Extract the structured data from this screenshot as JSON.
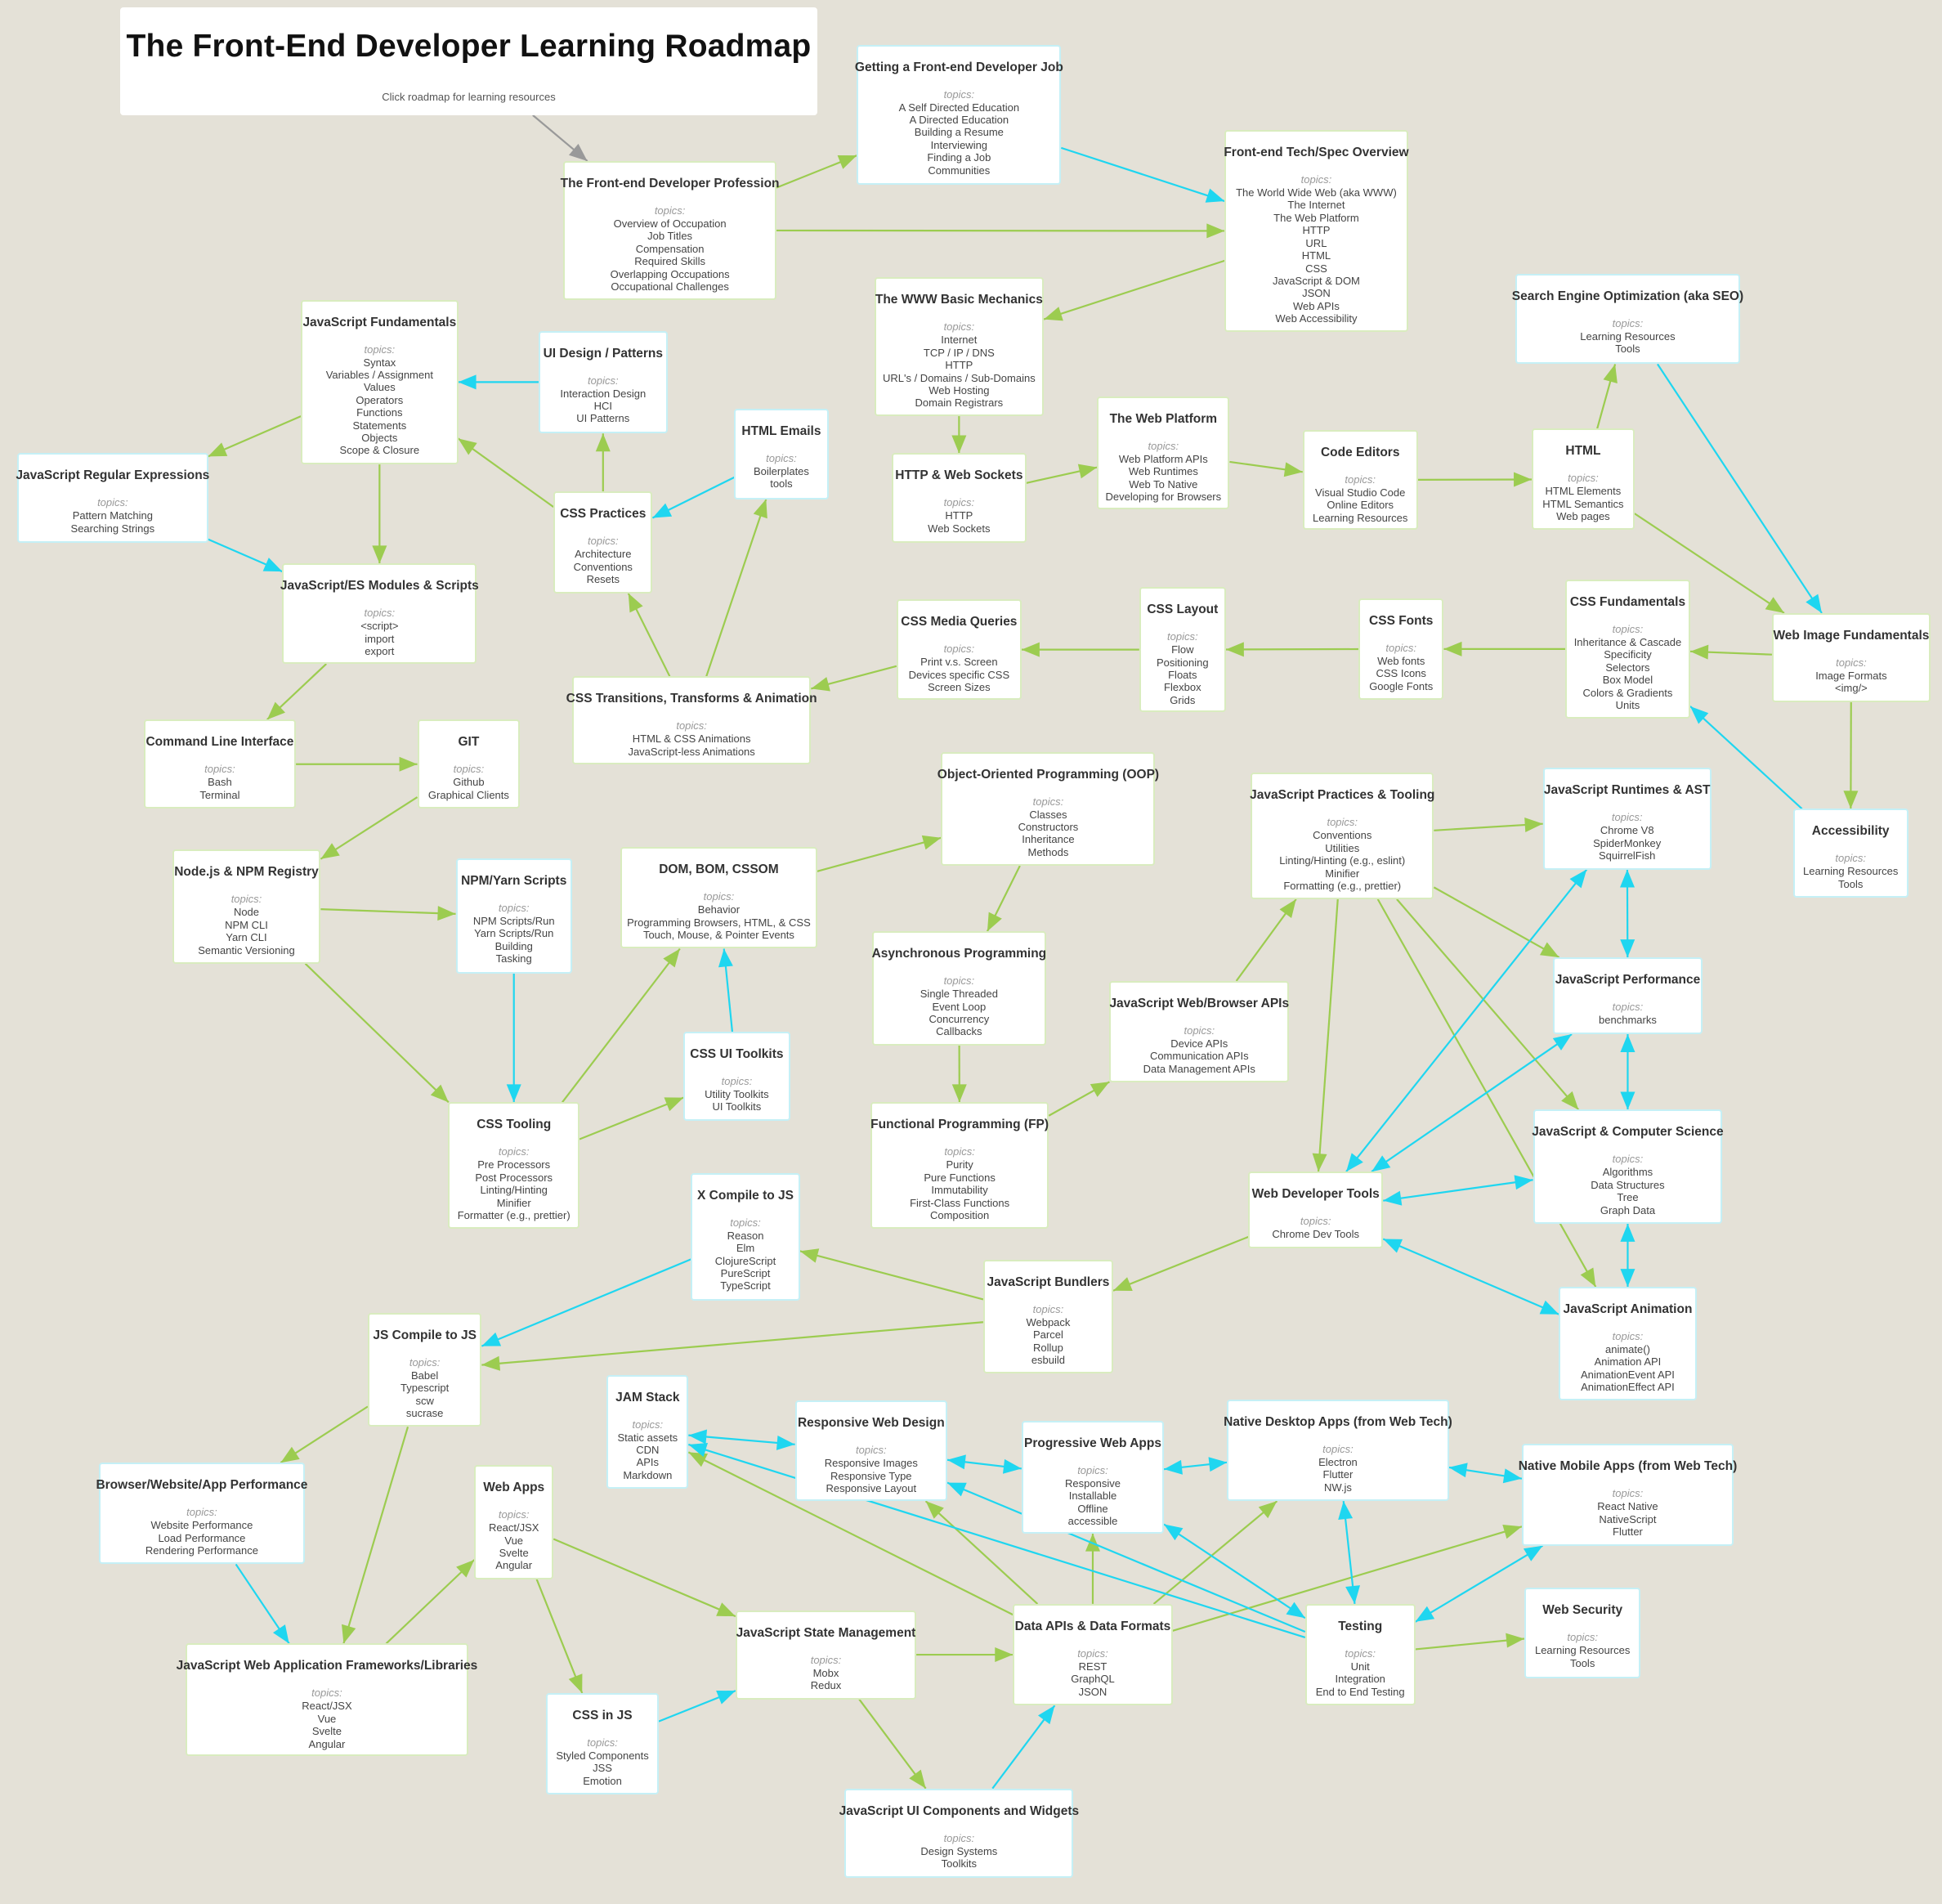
{
  "title": "The Front-End Developer Learning Roadmap",
  "subtitle": "Click roadmap for learning resources",
  "topics_label": "topics:",
  "colors": {
    "background": "#e4e1d7",
    "green_edge": "#9ccc50",
    "cyan_edge": "#1fd6f0",
    "gray_edge": "#999999",
    "box": "#ffffff"
  },
  "nodes": [
    {
      "id": "profession",
      "title": "The Front-end Developer Profession",
      "topics": [
        "Overview of Occupation",
        "Job Titles",
        "Compensation",
        "Required Skills",
        "Overlapping Occupations",
        "Occupational Challenges"
      ],
      "border": "green"
    },
    {
      "id": "job",
      "title": "Getting a Front-end Developer Job",
      "topics": [
        "A Self Directed Education",
        "A Directed Education",
        "Building a Resume",
        "Interviewing",
        "Finding a Job",
        "Communities"
      ],
      "border": "cyan"
    },
    {
      "id": "techspec",
      "title": "Front-end Tech/Spec Overview",
      "topics": [
        "The World Wide Web (aka WWW)",
        "The Internet",
        "The Web Platform",
        "HTTP",
        "URL",
        "HTML",
        "CSS",
        "JavaScript & DOM",
        "JSON",
        "Web APIs",
        "Web Accessibility"
      ],
      "border": "green"
    },
    {
      "id": "www",
      "title": "The WWW Basic Mechanics",
      "topics": [
        "Internet",
        "TCP / IP / DNS",
        "HTTP",
        "URL's / Domains / Sub-Domains",
        "Web Hosting",
        "Domain Registrars"
      ],
      "border": "green"
    },
    {
      "id": "jsfund",
      "title": "JavaScript Fundamentals",
      "topics": [
        "Syntax",
        "Variables / Assignment",
        "Values",
        "Operators",
        "Functions",
        "Statements",
        "Objects",
        "Scope & Closure"
      ],
      "border": "green"
    },
    {
      "id": "uidesign",
      "title": "UI Design / Patterns",
      "topics": [
        "Interaction Design",
        "HCI",
        "UI Patterns"
      ],
      "border": "cyan"
    },
    {
      "id": "htmlemails",
      "title": "HTML Emails",
      "topics": [
        "Boilerplates",
        "tools"
      ],
      "border": "cyan"
    },
    {
      "id": "regex",
      "title": "JavaScript Regular Expressions",
      "topics": [
        "Pattern Matching",
        "Searching Strings"
      ],
      "border": "cyan"
    },
    {
      "id": "csspractices",
      "title": "CSS Practices",
      "topics": [
        "Architecture",
        "Conventions",
        "Resets"
      ],
      "border": "green"
    },
    {
      "id": "modules",
      "title": "JavaScript/ES Modules & Scripts",
      "topics": [
        "<script>",
        "import",
        "export"
      ],
      "border": "green"
    },
    {
      "id": "httpws",
      "title": "HTTP & Web Sockets",
      "topics": [
        "HTTP",
        "Web Sockets"
      ],
      "border": "green"
    },
    {
      "id": "webplatform",
      "title": "The Web Platform",
      "topics": [
        "Web Platform APIs",
        "Web Runtimes",
        "Web To Native",
        "Developing for Browsers"
      ],
      "border": "green"
    },
    {
      "id": "codeeditors",
      "title": "Code Editors",
      "topics": [
        "Visual Studio Code",
        "Online Editors",
        "Learning Resources"
      ],
      "border": "green"
    },
    {
      "id": "html",
      "title": "HTML",
      "topics": [
        "HTML Elements",
        "HTML Semantics",
        "Web pages"
      ],
      "border": "green"
    },
    {
      "id": "seo",
      "title": "Search Engine Optimization (aka SEO)",
      "topics": [
        "Learning Resources",
        "Tools"
      ],
      "border": "cyan"
    },
    {
      "id": "webimage",
      "title": "Web Image Fundamentals",
      "topics": [
        "Image Formats",
        "<img/>"
      ],
      "border": "green"
    },
    {
      "id": "cssfund",
      "title": "CSS Fundamentals",
      "topics": [
        "Inheritance & Cascade",
        "Specificity",
        "Selectors",
        "Box Model",
        "Colors & Gradients",
        "Units"
      ],
      "border": "green"
    },
    {
      "id": "cssfonts",
      "title": "CSS Fonts",
      "topics": [
        "Web fonts",
        "CSS Icons",
        "Google Fonts"
      ],
      "border": "green"
    },
    {
      "id": "csslayout",
      "title": "CSS Layout",
      "topics": [
        "Flow",
        "Positioning",
        "Floats",
        "Flexbox",
        "Grids"
      ],
      "border": "green"
    },
    {
      "id": "mediaq",
      "title": "CSS Media Queries",
      "topics": [
        "Print v.s. Screen",
        "Devices specific CSS",
        "Screen Sizes"
      ],
      "border": "green"
    },
    {
      "id": "transitions",
      "title": "CSS Transitions, Transforms & Animation",
      "topics": [
        "HTML & CSS Animations",
        "JavaScript-less Animations"
      ],
      "border": "green"
    },
    {
      "id": "cli",
      "title": "Command Line Interface",
      "topics": [
        "Bash",
        "Terminal"
      ],
      "border": "green"
    },
    {
      "id": "git",
      "title": "GIT",
      "topics": [
        "Github",
        "Graphical Clients"
      ],
      "border": "green"
    },
    {
      "id": "oop",
      "title": "Object-Oriented Programming (OOP)",
      "topics": [
        "Classes",
        "Constructors",
        "Inheritance",
        "Methods"
      ],
      "border": "green"
    },
    {
      "id": "jspractices",
      "title": "JavaScript Practices & Tooling",
      "topics": [
        "Conventions",
        "Utilities",
        "Linting/Hinting (e.g., eslint)",
        "Minifier",
        "Formatting (e.g., prettier)"
      ],
      "border": "green"
    },
    {
      "id": "runtimes",
      "title": "JavaScript Runtimes & AST",
      "topics": [
        "Chrome V8",
        "SpiderMonkey",
        "SquirrelFish"
      ],
      "border": "cyan"
    },
    {
      "id": "accessibility",
      "title": "Accessibility",
      "topics": [
        "Learning Resources",
        "Tools"
      ],
      "border": "cyan"
    },
    {
      "id": "node",
      "title": "Node.js & NPM Registry",
      "topics": [
        "Node",
        "NPM CLI",
        "Yarn CLI",
        "Semantic Versioning"
      ],
      "border": "green"
    },
    {
      "id": "npm",
      "title": "NPM/Yarn Scripts",
      "topics": [
        "NPM Scripts/Run",
        "Yarn Scripts/Run",
        "Building",
        "Tasking"
      ],
      "border": "cyan"
    },
    {
      "id": "dom",
      "title": "DOM, BOM, CSSOM",
      "topics": [
        "Behavior",
        "Programming Browsers, HTML, & CSS",
        "Touch, Mouse, & Pointer Events"
      ],
      "border": "green"
    },
    {
      "id": "async",
      "title": "Asynchronous Programming",
      "topics": [
        "Single Threaded",
        "Event Loop",
        "Concurrency",
        "Callbacks"
      ],
      "border": "green"
    },
    {
      "id": "webapis",
      "title": "JavaScript Web/Browser APIs",
      "topics": [
        "Device APIs",
        "Communication APIs",
        "Data Management APIs"
      ],
      "border": "green"
    },
    {
      "id": "perf",
      "title": "JavaScript Performance",
      "topics": [
        "benchmarks"
      ],
      "border": "cyan"
    },
    {
      "id": "uitoolkits",
      "title": "CSS UI Toolkits",
      "topics": [
        "Utility Toolkits",
        "UI Toolkits"
      ],
      "border": "cyan"
    },
    {
      "id": "csstooling",
      "title": "CSS Tooling",
      "topics": [
        "Pre Processors",
        "Post Processors",
        "Linting/Hinting",
        "Minifier",
        "Formatter (e.g., prettier)"
      ],
      "border": "green"
    },
    {
      "id": "fp",
      "title": "Functional Programming (FP)",
      "topics": [
        "Purity",
        "Pure Functions",
        "Immutability",
        "First-Class Functions",
        "Composition"
      ],
      "border": "green"
    },
    {
      "id": "jscs",
      "title": "JavaScript & Computer Science",
      "topics": [
        "Algorithms",
        "Data Structures",
        "Tree",
        "Graph Data"
      ],
      "border": "cyan"
    },
    {
      "id": "devtools",
      "title": "Web Developer Tools",
      "topics": [
        "Chrome Dev Tools"
      ],
      "border": "green"
    },
    {
      "id": "xcompile",
      "title": "X Compile to JS",
      "topics": [
        "Reason",
        "Elm",
        "ClojureScript",
        "PureScript",
        "TypeScript"
      ],
      "border": "cyan"
    },
    {
      "id": "bundlers",
      "title": "JavaScript Bundlers",
      "topics": [
        "Webpack",
        "Parcel",
        "Rollup",
        "esbuild"
      ],
      "border": "green"
    },
    {
      "id": "animation",
      "title": "JavaScript Animation",
      "topics": [
        "animate()",
        "Animation API",
        "AnimationEvent API",
        "AnimationEffect API"
      ],
      "border": "cyan"
    },
    {
      "id": "jscompile",
      "title": "JS Compile to JS",
      "topics": [
        "Babel",
        "Typescript",
        "scw",
        "sucrase"
      ],
      "border": "green"
    },
    {
      "id": "jam",
      "title": "JAM Stack",
      "topics": [
        "Static assets",
        "CDN",
        "APIs",
        "Markdown"
      ],
      "border": "cyan"
    },
    {
      "id": "rwd",
      "title": "Responsive Web Design",
      "topics": [
        "Responsive Images",
        "Responsive Type",
        "Responsive Layout"
      ],
      "border": "cyan"
    },
    {
      "id": "pwa",
      "title": "Progressive Web Apps",
      "topics": [
        "Responsive",
        "Installable",
        "Offline",
        "accessible"
      ],
      "border": "cyan"
    },
    {
      "id": "desktop",
      "title": "Native Desktop Apps (from Web Tech)",
      "topics": [
        "Electron",
        "Flutter",
        "NW.js"
      ],
      "border": "cyan"
    },
    {
      "id": "mobile",
      "title": "Native Mobile Apps (from Web Tech)",
      "topics": [
        "React Native",
        "NativeScript",
        "Flutter"
      ],
      "border": "cyan"
    },
    {
      "id": "browserperf",
      "title": "Browser/Website/App Performance",
      "topics": [
        "Website Performance",
        "Load Performance",
        "Rendering Performance"
      ],
      "border": "cyan"
    },
    {
      "id": "webapps",
      "title": "Web Apps",
      "topics": [
        "React/JSX",
        "Vue",
        "Svelte",
        "Angular"
      ],
      "border": "green"
    },
    {
      "id": "statemgmt",
      "title": "JavaScript State Management",
      "topics": [
        "Mobx",
        "Redux"
      ],
      "border": "green"
    },
    {
      "id": "dataapis",
      "title": "Data APIs & Data Formats",
      "topics": [
        "REST",
        "GraphQL",
        "JSON"
      ],
      "border": "green"
    },
    {
      "id": "testing",
      "title": "Testing",
      "topics": [
        "Unit",
        "Integration",
        "End to End Testing"
      ],
      "border": "green"
    },
    {
      "id": "security",
      "title": "Web Security",
      "topics": [
        "Learning Resources",
        "Tools"
      ],
      "border": "cyan"
    },
    {
      "id": "frameworks",
      "title": "JavaScript Web Application Frameworks/Libraries",
      "topics": [
        "React/JSX",
        "Vue",
        "Svelte",
        "Angular"
      ],
      "border": "green"
    },
    {
      "id": "cssinjs",
      "title": "CSS in JS",
      "topics": [
        "Styled Components",
        "JSS",
        "Emotion"
      ],
      "border": "cyan"
    },
    {
      "id": "uicomponents",
      "title": "JavaScript UI Components and Widgets",
      "topics": [
        "Design Systems",
        "Toolkits"
      ],
      "border": "cyan"
    }
  ],
  "edges": [
    {
      "from": "title",
      "to": "profession",
      "color": "gray"
    },
    {
      "from": "profession",
      "to": "job",
      "color": "green"
    },
    {
      "from": "profession",
      "to": "techspec",
      "color": "green"
    },
    {
      "from": "job",
      "to": "techspec",
      "color": "cyan"
    },
    {
      "from": "techspec",
      "to": "www",
      "color": "green"
    },
    {
      "from": "www",
      "to": "httpws",
      "color": "green"
    },
    {
      "from": "httpws",
      "to": "webplatform",
      "color": "green"
    },
    {
      "from": "webplatform",
      "to": "codeeditors",
      "color": "green"
    },
    {
      "from": "codeeditors",
      "to": "html",
      "color": "green"
    },
    {
      "from": "html",
      "to": "seo",
      "color": "green"
    },
    {
      "from": "html",
      "to": "webimage",
      "color": "green"
    },
    {
      "from": "seo",
      "to": "webimage",
      "color": "cyan"
    },
    {
      "from": "webimage",
      "to": "cssfund",
      "color": "green"
    },
    {
      "from": "webimage",
      "to": "accessibility",
      "color": "green"
    },
    {
      "from": "accessibility",
      "to": "cssfund",
      "color": "cyan"
    },
    {
      "from": "cssfund",
      "to": "cssfonts",
      "color": "green"
    },
    {
      "from": "cssfonts",
      "to": "csslayout",
      "color": "green"
    },
    {
      "from": "csslayout",
      "to": "mediaq",
      "color": "green"
    },
    {
      "from": "mediaq",
      "to": "transitions",
      "color": "green"
    },
    {
      "from": "transitions",
      "to": "csspractices",
      "color": "green"
    },
    {
      "from": "transitions",
      "to": "htmlemails",
      "color": "green"
    },
    {
      "from": "htmlemails",
      "to": "csspractices",
      "color": "cyan"
    },
    {
      "from": "csspractices",
      "to": "uidesign",
      "color": "green"
    },
    {
      "from": "csspractices",
      "to": "jsfund",
      "color": "green"
    },
    {
      "from": "uidesign",
      "to": "jsfund",
      "color": "cyan"
    },
    {
      "from": "jsfund",
      "to": "regex",
      "color": "green"
    },
    {
      "from": "jsfund",
      "to": "modules",
      "color": "green"
    },
    {
      "from": "regex",
      "to": "modules",
      "color": "cyan"
    },
    {
      "from": "modules",
      "to": "cli",
      "color": "green"
    },
    {
      "from": "cli",
      "to": "git",
      "color": "green"
    },
    {
      "from": "git",
      "to": "node",
      "color": "green"
    },
    {
      "from": "node",
      "to": "npm",
      "color": "green"
    },
    {
      "from": "node",
      "to": "csstooling",
      "color": "green"
    },
    {
      "from": "npm",
      "to": "csstooling",
      "color": "cyan"
    },
    {
      "from": "csstooling",
      "to": "dom",
      "color": "green"
    },
    {
      "from": "csstooling",
      "to": "uitoolkits",
      "color": "green"
    },
    {
      "from": "uitoolkits",
      "to": "dom",
      "color": "cyan"
    },
    {
      "from": "dom",
      "to": "oop",
      "color": "green"
    },
    {
      "from": "oop",
      "to": "async",
      "color": "green"
    },
    {
      "from": "async",
      "to": "fp",
      "color": "green"
    },
    {
      "from": "fp",
      "to": "webapis",
      "color": "green"
    },
    {
      "from": "webapis",
      "to": "jspractices",
      "color": "green"
    },
    {
      "from": "jspractices",
      "to": "runtimes",
      "color": "green"
    },
    {
      "from": "jspractices",
      "to": "perf",
      "color": "green"
    },
    {
      "from": "jspractices",
      "to": "jscs",
      "color": "green"
    },
    {
      "from": "jspractices",
      "to": "devtools",
      "color": "green"
    },
    {
      "from": "jspractices",
      "to": "animation",
      "color": "green"
    },
    {
      "from": "runtimes",
      "to": "perf",
      "color": "cyan",
      "both": true
    },
    {
      "from": "perf",
      "to": "jscs",
      "color": "cyan",
      "both": true
    },
    {
      "from": "jscs",
      "to": "animation",
      "color": "cyan",
      "both": true
    },
    {
      "from": "devtools",
      "to": "runtimes",
      "color": "cyan",
      "both": true
    },
    {
      "from": "devtools",
      "to": "perf",
      "color": "cyan",
      "both": true
    },
    {
      "from": "devtools",
      "to": "jscs",
      "color": "cyan",
      "both": true
    },
    {
      "from": "devtools",
      "to": "animation",
      "color": "cyan",
      "both": true
    },
    {
      "from": "devtools",
      "to": "bundlers",
      "color": "green"
    },
    {
      "from": "bundlers",
      "to": "xcompile",
      "color": "green"
    },
    {
      "from": "bundlers",
      "to": "jscompile",
      "color": "green"
    },
    {
      "from": "xcompile",
      "to": "jscompile",
      "color": "cyan"
    },
    {
      "from": "jscompile",
      "to": "browserperf",
      "color": "green"
    },
    {
      "from": "jscompile",
      "to": "frameworks",
      "color": "green"
    },
    {
      "from": "browserperf",
      "to": "frameworks",
      "color": "cyan"
    },
    {
      "from": "frameworks",
      "to": "webapps",
      "color": "green"
    },
    {
      "from": "webapps",
      "to": "cssinjs",
      "color": "green"
    },
    {
      "from": "webapps",
      "to": "statemgmt",
      "color": "green"
    },
    {
      "from": "cssinjs",
      "to": "statemgmt",
      "color": "cyan"
    },
    {
      "from": "statemgmt",
      "to": "dataapis",
      "color": "green"
    },
    {
      "from": "statemgmt",
      "to": "uicomponents",
      "color": "green"
    },
    {
      "from": "uicomponents",
      "to": "dataapis",
      "color": "cyan"
    },
    {
      "from": "dataapis",
      "to": "jam",
      "color": "green"
    },
    {
      "from": "dataapis",
      "to": "rwd",
      "color": "green"
    },
    {
      "from": "dataapis",
      "to": "pwa",
      "color": "green"
    },
    {
      "from": "dataapis",
      "to": "desktop",
      "color": "green"
    },
    {
      "from": "dataapis",
      "to": "mobile",
      "color": "green"
    },
    {
      "from": "jam",
      "to": "rwd",
      "color": "cyan",
      "both": true
    },
    {
      "from": "rwd",
      "to": "pwa",
      "color": "cyan",
      "both": true
    },
    {
      "from": "pwa",
      "to": "desktop",
      "color": "cyan",
      "both": true
    },
    {
      "from": "desktop",
      "to": "mobile",
      "color": "cyan",
      "both": true
    },
    {
      "from": "testing",
      "to": "jam",
      "color": "cyan"
    },
    {
      "from": "testing",
      "to": "rwd",
      "color": "cyan"
    },
    {
      "from": "testing",
      "to": "pwa",
      "color": "cyan",
      "both": true
    },
    {
      "from": "testing",
      "to": "desktop",
      "color": "cyan",
      "both": true
    },
    {
      "from": "testing",
      "to": "mobile",
      "color": "cyan",
      "both": true
    },
    {
      "from": "testing",
      "to": "security",
      "color": "green"
    }
  ]
}
